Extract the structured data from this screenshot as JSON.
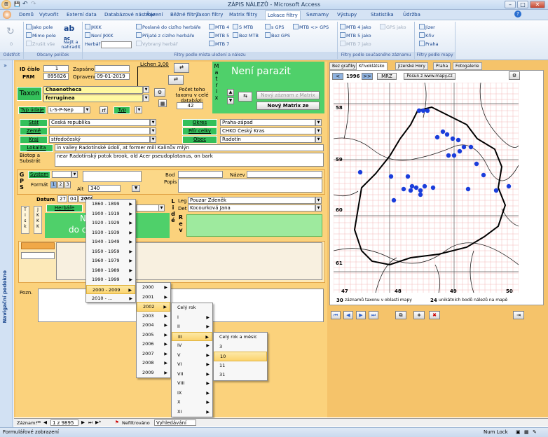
{
  "window": {
    "title": "ZÁPIS NÁLEZŮ - Microsoft Access",
    "min": "–",
    "max": "□",
    "close": "✕"
  },
  "qat": {
    "office_icon": "⊞",
    "save": "💾",
    "undo": "↶",
    "redo": "↷"
  },
  "menu": [
    "Domů",
    "Vytvořit",
    "Externí data",
    "Databázové nástroje",
    "Řazení",
    "Běžné filtry",
    "Taxon filtry",
    "Matrix filtry",
    "Lokace filtry",
    "Seznamy",
    "Výstupy",
    "Statistika",
    "Údržba"
  ],
  "menu_active": "Lokace filtry",
  "ribbon": {
    "odstrcit": {
      "label": "Odstřcit",
      "value": "0"
    },
    "obcany": {
      "items": [
        "Jako pole",
        "Mimo pole",
        "Zrušit vše"
      ],
      "big": "Najít a nahradit",
      "group": "Obcany políček"
    },
    "filtry_mista": {
      "col1": [
        "JKKK",
        "Není JKKK",
        "Herbář"
      ],
      "col2": [
        "Poslané do cizího herbáře",
        "Přijaté z cizího herbáře",
        "Vybraný herbář"
      ],
      "col3": [
        "MTB 4",
        "MTB 5",
        "MTB 7"
      ],
      "col4": [
        "S MTB",
        "Bez MTB"
      ],
      "col5": [
        "s GPS",
        "Bez GPS"
      ],
      "col6": [
        "MTB <> GPS"
      ],
      "group": "Filtry podle místa uložení a nálezu"
    },
    "filtry_zaznamu": {
      "col1": [
        "MTB 4 jako",
        "MTB 5 jako",
        "MTB 7 jako"
      ],
      "col2": [
        "GPS jako"
      ],
      "group": "Filtry podle současného záznamu"
    },
    "filtry_mapy": {
      "items": [
        "Jizer",
        "Křiv",
        "Praha"
      ],
      "group": "Filtry podle mapy"
    }
  },
  "nav_pane": {
    "label": "Navigační podokno",
    "toggle": "»"
  },
  "form": {
    "id_cislo_label": "ID číslo",
    "id_cislo": "1",
    "prm_label": "PRM",
    "prm": "895826",
    "zapsano_label": "Zapsáno",
    "zapsano": "",
    "opraveno_label": "Opraveno",
    "opraveno": "09-01-2019",
    "lichen": "Lichen 3,00",
    "matrix_letters": [
      "M",
      "a",
      "t",
      "r",
      "i",
      "x"
    ],
    "neni_parazit": "Není parazit",
    "novy_zaznam": "Nový záznam z Matrix",
    "novy_matrix": "Nový Matrix ze",
    "taxon_label": "Taxon",
    "taxon_1": "Chaenotheca",
    "taxon_2": "ferruginea",
    "pocet_label": "Počet toho taxonu v celé databázi:",
    "pocet": "42",
    "typ_udaje_label": "Typ údaje",
    "typ_udaje": "L-S-P-Nep",
    "typ_label": "Typ",
    "stat_label": "Stát",
    "stat": "Česká republika",
    "zeme_label": "Země",
    "zeme": "",
    "kraj_label": "Kraj",
    "kraj": "středočeský",
    "okres_label": "Okres",
    "okres": "Praha-západ",
    "chko_label": "Přír celky",
    "chko": "CHKO Český Kras",
    "obec_label": "Obec",
    "obec": "Radotín",
    "lokalita_label": "Lokalita",
    "lokalita": "in valley Radotínské údolí, at former mill Kalinův mlýn",
    "biotop_label": "Biotop a Substrát",
    "biotop": "near Radotínský potok brook, old Acer pseudoplatanus, on bark",
    "gps_letters": [
      "G",
      "P",
      "S"
    ],
    "system_label": "System",
    "format_label": "Formát",
    "format_btns": [
      "1",
      "2",
      "3"
    ],
    "alt_label": "Alt",
    "alt": "340",
    "bod_label": "Bod",
    "nazev_label": "Název",
    "popis_label": "Popis",
    "datum_label": "Datum",
    "datum_d": "27",
    "datum_m": "04",
    "datum_y": "2009",
    "herbare_label": "Herbáře",
    "tisk": [
      "T",
      "i",
      "s",
      "k"
    ],
    "jkkk": [
      "J",
      "K",
      "K",
      "K"
    ],
    "nic_text": "Nic",
    "do_text": "do c",
    "lide": [
      "L",
      "i",
      "d",
      "é"
    ],
    "leg_label": "Leg",
    "leg": "Pouzar Zdeněk",
    "det_label": "Det",
    "det": "Kocourková Jana",
    "rev": [
      "R",
      "e",
      "v"
    ],
    "pozn_label": "Pozn."
  },
  "date_menu": {
    "decades": [
      "1860 - 1899",
      "1900 - 1919",
      "1920 - 1929",
      "1930 - 1939",
      "1940 - 1949",
      "1950 - 1959",
      "1960 - 1979",
      "1980 - 1989",
      "1990 - 1999",
      "2000 - 2009",
      "2010 - ..."
    ],
    "years": [
      "2000",
      "2001",
      "2002",
      "2003",
      "2004",
      "2005",
      "2006",
      "2007",
      "2008",
      "2009"
    ],
    "months": [
      "Celý rok",
      "I",
      "II",
      "III",
      "IV",
      "V",
      "VI",
      "VII",
      "VIII",
      "IX",
      "X",
      "XI"
    ],
    "days": [
      "Celý rok a měsíc",
      "3",
      "10",
      "11",
      "31"
    ]
  },
  "map": {
    "tabs": [
      "Bez grafiky",
      "Křivoklátsko",
      "Jizerské Hory",
      "Praha",
      "Fotogalerie"
    ],
    "year": "1996",
    "prev": "<",
    "next": ">>",
    "mrz": "MRZ",
    "posun": "Posun z www.mapy.cz",
    "y_labels": [
      "58",
      "59",
      "60",
      "61"
    ],
    "x_labels": [
      "47",
      "48",
      "49",
      "50"
    ],
    "count_left": "30",
    "text_left": "záznamů taxonu v oblasti mapy",
    "count_right": "24",
    "text_right": "unikátních bodů nálezů na mapě"
  },
  "recnav": {
    "label": "Záznam:",
    "pos": "1 z 9895",
    "filter": "Nefiltrováno",
    "search": "Vyhledávání"
  },
  "status": {
    "left": "Formulářové zobrazení",
    "right": "Num Lock"
  }
}
